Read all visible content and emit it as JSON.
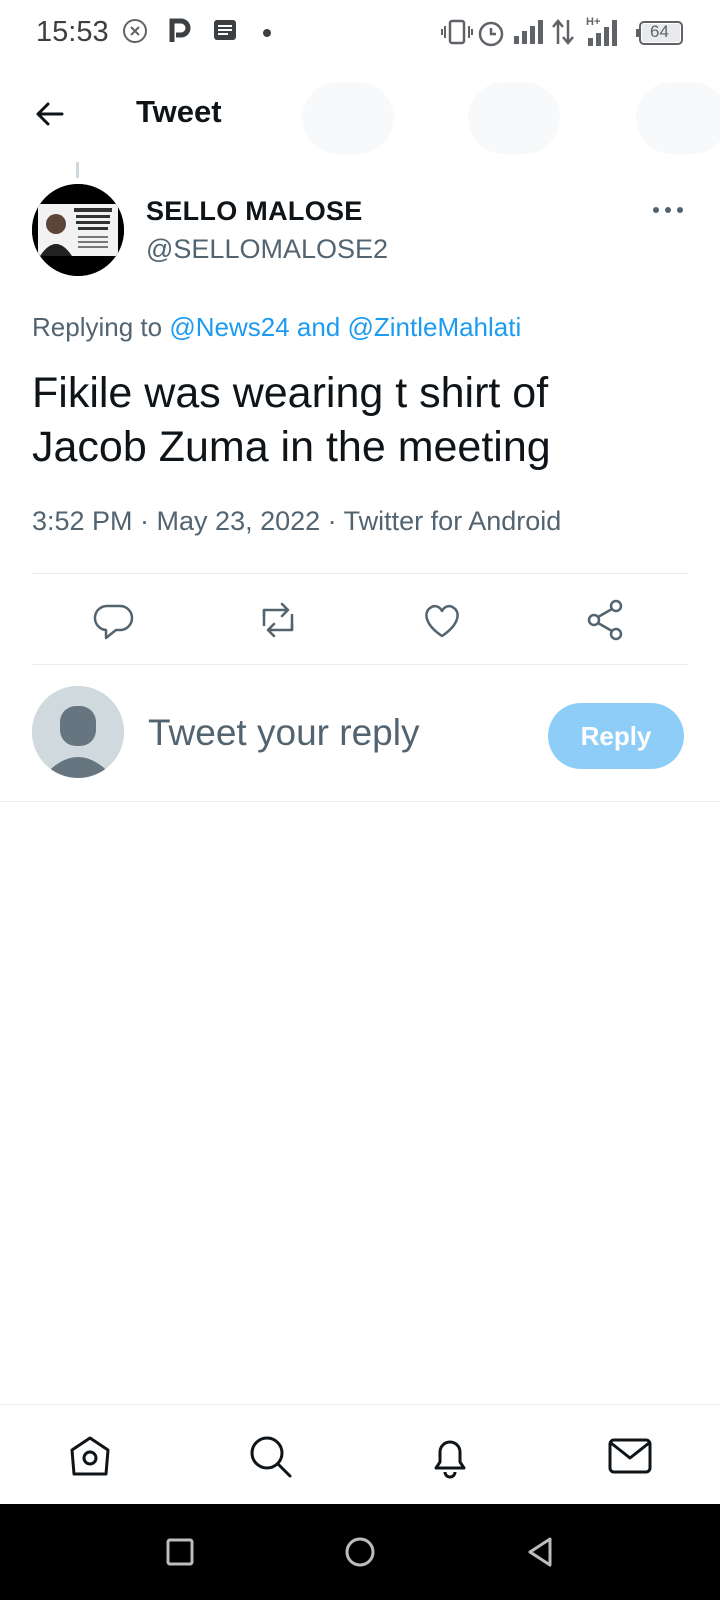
{
  "status_bar": {
    "time": "15:53",
    "battery": "64",
    "left_icons": [
      "close-circle-icon",
      "p-icon",
      "message-icon",
      "dot-icon"
    ],
    "right_icons": [
      "vibrate-icon",
      "alarm-icon",
      "signal-icon",
      "data-arrows-icon",
      "hplus-signal-icon",
      "battery-icon"
    ]
  },
  "header": {
    "title": "Tweet",
    "back_icon": "arrow-left-icon"
  },
  "tweet": {
    "display_name": "SELLO MALOSE",
    "handle": "@SELLOMALOSE2",
    "replying_prefix": "Replying to",
    "replying_to": "@News24 and @ZintleMahlati",
    "text_line1": "Fikile was wearing t shirt of",
    "text_line2": "Jacob Zuma in the meeting",
    "meta": "3:52 PM · May 23, 2022 · Twitter for Android",
    "avatar_caption": "\"Mmuso wa ANC ke mmuso wa mapantiti, o tlile go le sotla banake\""
  },
  "actions": [
    "reply-icon",
    "retweet-icon",
    "like-icon",
    "share-icon"
  ],
  "composer": {
    "placeholder": "Tweet your reply",
    "button_label": "Reply"
  },
  "colors": {
    "accent": "#1d9bf0",
    "reply_button_disabled": "#8ecdf7",
    "secondary_text": "#536471"
  },
  "bottom_nav": [
    "home-icon",
    "search-icon",
    "notifications-icon",
    "messages-icon"
  ],
  "system_nav": [
    "recents-icon",
    "home-circle-icon",
    "back-triangle-icon"
  ]
}
